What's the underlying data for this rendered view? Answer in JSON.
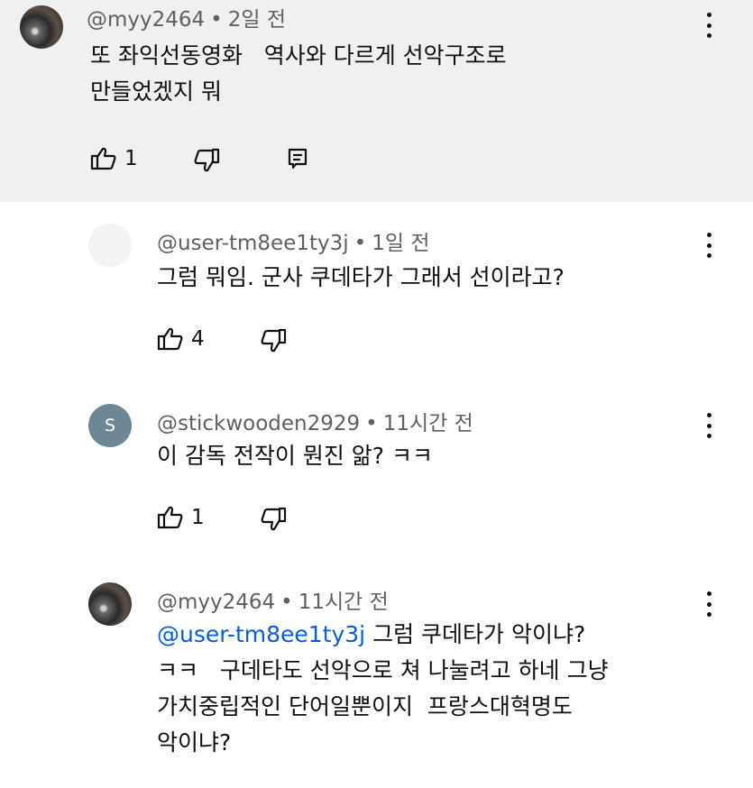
{
  "comments": [
    {
      "author": "@myy2464",
      "time": "2일 전",
      "text": "또 좌익선동영화   역사와 다르게 선악구조로\n만들었겠지 뭐",
      "likes": "1"
    },
    {
      "author": "@user-tm8ee1ty3j",
      "time": "1일 전",
      "text": "그럼 뭐임. 군사 쿠데타가 그래서 선이라고?",
      "likes": "4"
    },
    {
      "author": "@stickwooden2929",
      "time": "11시간 전",
      "avatar_letter": "S",
      "text": "이 감독 전작이 뭔진 앎? ㅋㅋ",
      "likes": "1"
    },
    {
      "author": "@myy2464",
      "time": "11시간 전",
      "mention": "@user-tm8ee1ty3j",
      "text_first": " 그럼 쿠데타가 악이냐?",
      "text_rest": "ㅋㅋ   구데타도 선악으로 쳐 나눌려고 하네 그냥\n가치중립적인 단어일뿐이지  프랑스대혁명도\n악이냐?"
    }
  ],
  "separator": "•",
  "colors": {
    "highlight_bg": "#f0f0f0",
    "mention": "#065fd4",
    "meta": "#606060",
    "avatar_letter_bg": "#6e8797"
  }
}
